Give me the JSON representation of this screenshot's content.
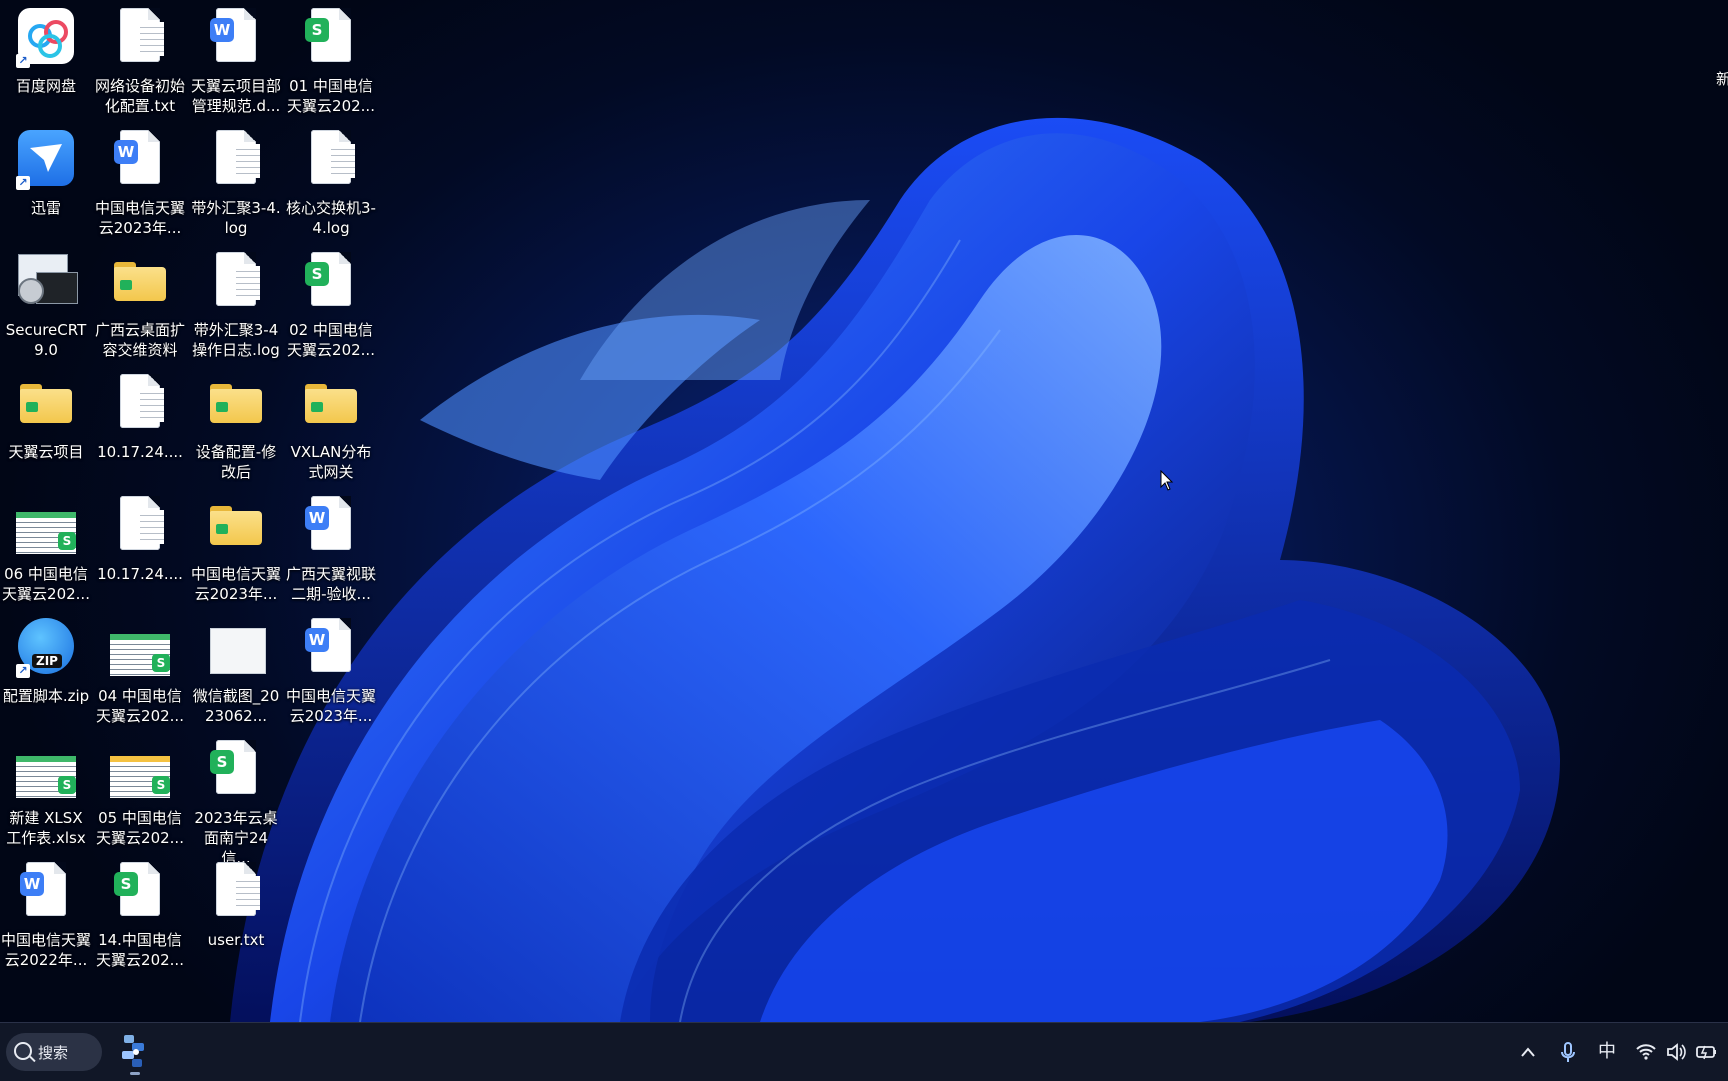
{
  "desktop": {
    "icons": [
      {
        "label": "百度网盘",
        "type": "app-baidu"
      },
      {
        "label": "网络设备初始化配置.txt",
        "type": "txt"
      },
      {
        "label": "天翼云项目部管理规范.d...",
        "type": "word"
      },
      {
        "label": "01 中国电信天翼云202...",
        "type": "sheet"
      },
      {
        "label": "迅雷",
        "type": "app-xunlei"
      },
      {
        "label": "中国电信天翼云2023年...",
        "type": "word"
      },
      {
        "label": "带外汇聚3-4.log",
        "type": "txt"
      },
      {
        "label": "核心交换机3-4.log",
        "type": "txt"
      },
      {
        "label": "SecureCRT 9.0",
        "type": "app-securecrt"
      },
      {
        "label": "广西云桌面扩容交维资料",
        "type": "folder"
      },
      {
        "label": "带外汇聚3-4操作日志.log",
        "type": "txt"
      },
      {
        "label": "02 中国电信天翼云202...",
        "type": "sheet"
      },
      {
        "label": "天翼云项目",
        "type": "folder"
      },
      {
        "label": "10.17.24....",
        "type": "txt"
      },
      {
        "label": "设备配置-修改后",
        "type": "folder"
      },
      {
        "label": "VXLAN分布式网关",
        "type": "folder"
      },
      {
        "label": "06 中国电信天翼云202...",
        "type": "sheet-thumb"
      },
      {
        "label": "10.17.24....",
        "type": "txt"
      },
      {
        "label": "中国电信天翼云2023年...",
        "type": "folder"
      },
      {
        "label": "广西天翼视联二期-验收...",
        "type": "word"
      },
      {
        "label": "配置脚本.zip",
        "type": "zip"
      },
      {
        "label": "04 中国电信天翼云202...",
        "type": "sheet-thumb"
      },
      {
        "label": "微信截图_2023062...",
        "type": "image"
      },
      {
        "label": "中国电信天翼云2023年...",
        "type": "word"
      },
      {
        "label": "新建 XLSX 工作表.xlsx",
        "type": "sheet-thumb"
      },
      {
        "label": "05 中国电信天翼云202...",
        "type": "sheet-thumb-yellow"
      },
      {
        "label": "2023年云桌面南宁24信...",
        "type": "sheet"
      },
      {
        "label": "中国电信天翼云2022年...",
        "type": "word"
      },
      {
        "label": "14.中国电信天翼云202...",
        "type": "sheet"
      },
      {
        "label": "user.txt",
        "type": "txt"
      }
    ],
    "edge_text": "新"
  },
  "taskbar": {
    "search_label": "搜索",
    "ime_label": "中",
    "icons": [
      "search-icon",
      "pinned-app-icon",
      "show-hidden-icons-chevron",
      "microphone-icon",
      "wifi-icon",
      "volume-icon",
      "battery-icon"
    ]
  },
  "colors": {
    "accent": "#3d7ef6",
    "sheet": "#21b15a",
    "folder": "#f3c74c",
    "taskbar": "#121828"
  }
}
